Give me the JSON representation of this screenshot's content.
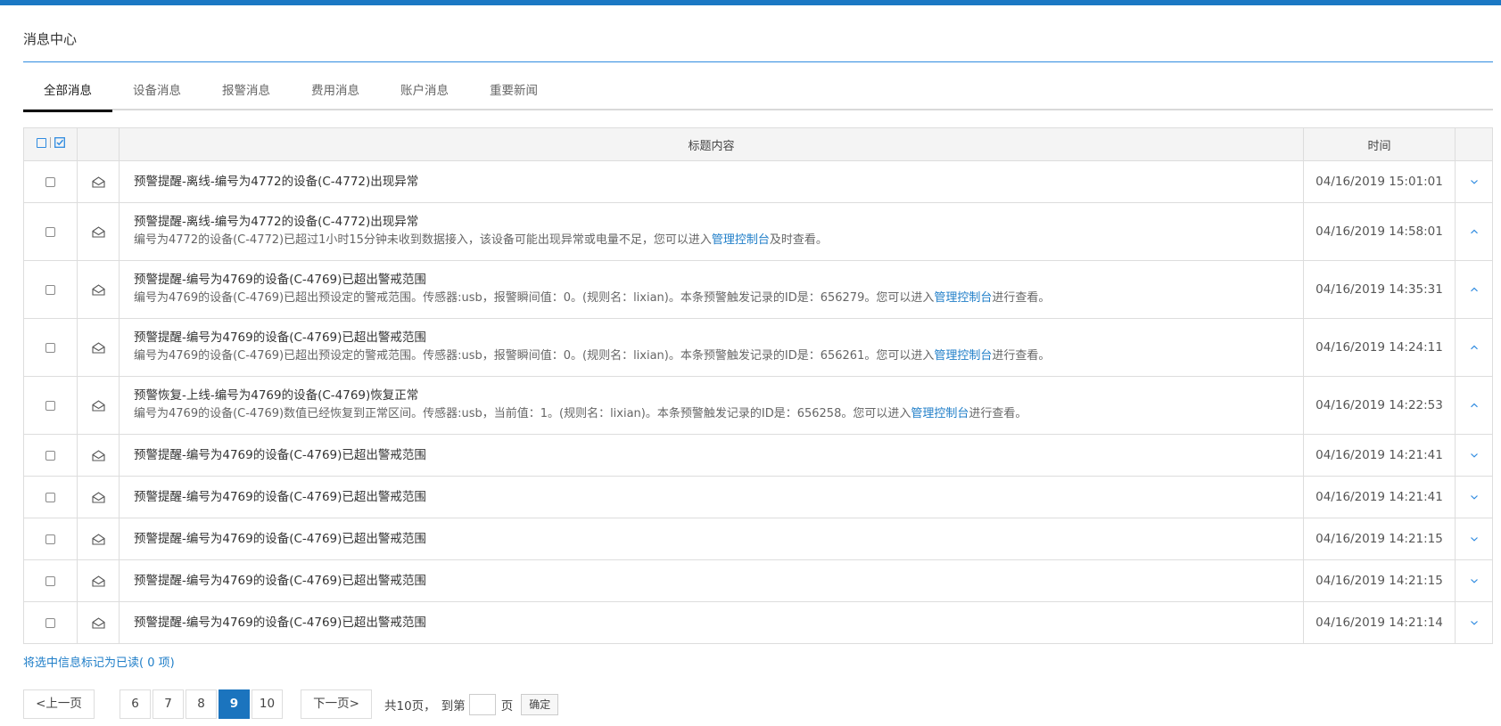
{
  "page_title": "消息中心",
  "tabs": [
    {
      "label": "全部消息",
      "active": true
    },
    {
      "label": "设备消息",
      "active": false
    },
    {
      "label": "报警消息",
      "active": false
    },
    {
      "label": "费用消息",
      "active": false
    },
    {
      "label": "账户消息",
      "active": false
    },
    {
      "label": "重要新闻",
      "active": false
    }
  ],
  "table": {
    "header_title": "标题内容",
    "header_time": "时间",
    "rows": [
      {
        "title": "预警提醒-离线-编号为4772的设备(C-4772)出现异常",
        "time": "04/16/2019 15:01:01",
        "expanded": false
      },
      {
        "title": "预警提醒-离线-编号为4772的设备(C-4772)出现异常",
        "time": "04/16/2019 14:58:01",
        "expanded": true,
        "body_pre": "编号为4772的设备(C-4772)已超过1小时15分钟未收到数据接入，该设备可能出现异常或电量不足，您可以进入",
        "body_link": "管理控制台",
        "body_post": "及时查看。"
      },
      {
        "title": "预警提醒-编号为4769的设备(C-4769)已超出警戒范围",
        "time": "04/16/2019 14:35:31",
        "expanded": true,
        "body_pre": "编号为4769的设备(C-4769)已超出预设定的警戒范围。传感器:usb，报警瞬间值：0。(规则名：lixian)。本条预警触发记录的ID是：656279。您可以进入",
        "body_link": "管理控制台",
        "body_post": "进行查看。"
      },
      {
        "title": "预警提醒-编号为4769的设备(C-4769)已超出警戒范围",
        "time": "04/16/2019 14:24:11",
        "expanded": true,
        "body_pre": "编号为4769的设备(C-4769)已超出预设定的警戒范围。传感器:usb，报警瞬间值：0。(规则名：lixian)。本条预警触发记录的ID是：656261。您可以进入",
        "body_link": "管理控制台",
        "body_post": "进行查看。"
      },
      {
        "title": "预警恢复-上线-编号为4769的设备(C-4769)恢复正常",
        "time": "04/16/2019 14:22:53",
        "expanded": true,
        "body_pre": "编号为4769的设备(C-4769)数值已经恢复到正常区间。传感器:usb，当前值：1。(规则名：lixian)。本条预警触发记录的ID是：656258。您可以进入",
        "body_link": "管理控制台",
        "body_post": "进行查看。"
      },
      {
        "title": "预警提醒-编号为4769的设备(C-4769)已超出警戒范围",
        "time": "04/16/2019 14:21:41",
        "expanded": false
      },
      {
        "title": "预警提醒-编号为4769的设备(C-4769)已超出警戒范围",
        "time": "04/16/2019 14:21:41",
        "expanded": false
      },
      {
        "title": "预警提醒-编号为4769的设备(C-4769)已超出警戒范围",
        "time": "04/16/2019 14:21:15",
        "expanded": false
      },
      {
        "title": "预警提醒-编号为4769的设备(C-4769)已超出警戒范围",
        "time": "04/16/2019 14:21:15",
        "expanded": false
      },
      {
        "title": "预警提醒-编号为4769的设备(C-4769)已超出警戒范围",
        "time": "04/16/2019 14:21:14",
        "expanded": false
      }
    ]
  },
  "mark_read": "将选中信息标记为已读( 0 项)",
  "pager": {
    "prev": "<上一页",
    "pages": [
      "6",
      "7",
      "8",
      "9",
      "10"
    ],
    "current": "9",
    "next": "下一页>",
    "total": "共10页，",
    "goto": "到第",
    "unit": "页",
    "confirm": "确定"
  },
  "icons": {
    "row_icon": "envelope-open-icon",
    "collapsed_arrow": "chevron-down-icon",
    "expanded_arrow": "chevron-up-icon"
  },
  "colors": {
    "accent": "#1b78c4",
    "link": "#1f7ec8",
    "active_page": "#1b74be"
  }
}
